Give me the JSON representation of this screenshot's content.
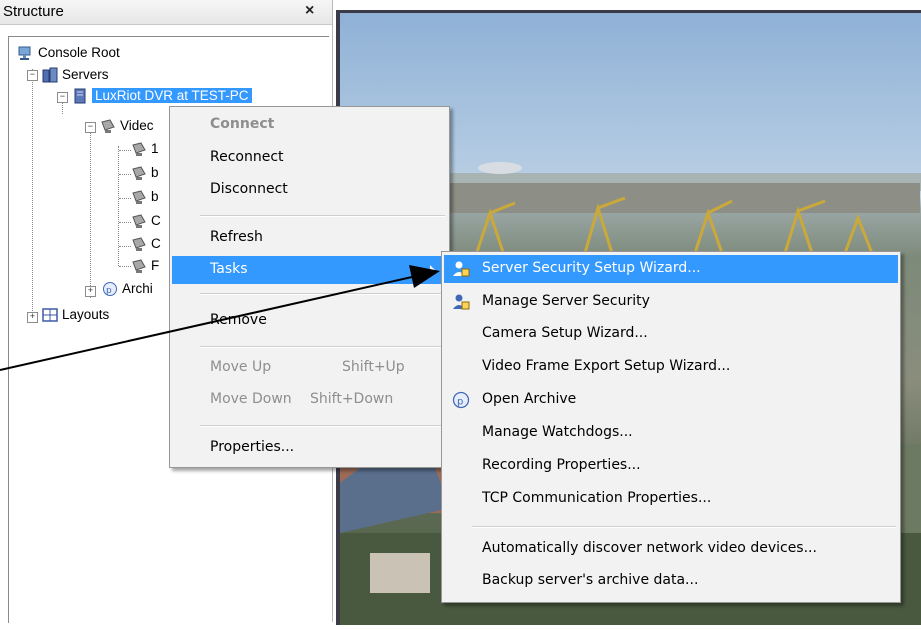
{
  "panel": {
    "title": "Structure",
    "close_glyph": "×"
  },
  "tree": {
    "console_root": "Console Root",
    "servers": "Servers",
    "server": "LuxRiot DVR at TEST-PC",
    "video": "Videc",
    "video_children": [
      "1",
      "b",
      "b",
      "C",
      "C",
      "F"
    ],
    "archive": "Archi",
    "layouts": "Layouts",
    "icons": {
      "console_root": "console-root-icon",
      "servers": "servers-icon",
      "server": "server-icon",
      "camera": "camera-icon",
      "archive": "archive-icon",
      "layouts": "layouts-icon"
    }
  },
  "context_menu": {
    "items": [
      {
        "label": "Connect",
        "state": "disabled-bold"
      },
      {
        "label": "Reconnect",
        "state": "normal"
      },
      {
        "label": "Disconnect",
        "state": "normal"
      },
      {
        "label": "Refresh",
        "state": "normal"
      },
      {
        "label": "Tasks",
        "state": "highlighted"
      },
      {
        "label": "Remove",
        "state": "normal"
      },
      {
        "label": "Move Up",
        "shortcut": "Shift+Up",
        "state": "disabled"
      },
      {
        "label": "Move Down",
        "shortcut": "Shift+Down",
        "state": "disabled"
      },
      {
        "label": "Properties...",
        "state": "normal"
      }
    ]
  },
  "tasks_menu": {
    "items": [
      {
        "label": "Server Security Setup Wizard...",
        "icon": "security-icon",
        "state": "highlighted"
      },
      {
        "label": "Manage Server Security",
        "icon": "security-icon",
        "state": "normal"
      },
      {
        "label": "Camera Setup Wizard...",
        "state": "normal"
      },
      {
        "label": "Video Frame Export Setup Wizard...",
        "state": "normal"
      },
      {
        "label": "Open Archive",
        "icon": "archive-icon",
        "state": "normal"
      },
      {
        "label": "Manage Watchdogs...",
        "state": "normal"
      },
      {
        "label": "Recording Properties...",
        "state": "normal"
      },
      {
        "label": "TCP Communication Properties...",
        "state": "normal"
      },
      {
        "label": "Automatically discover network video devices...",
        "state": "normal"
      },
      {
        "label": "Backup server's archive data...",
        "state": "normal"
      }
    ]
  },
  "colors": {
    "highlight": "#3399ff",
    "disabled_text": "#8e8e8e",
    "menu_bg": "#f2f2f2"
  }
}
